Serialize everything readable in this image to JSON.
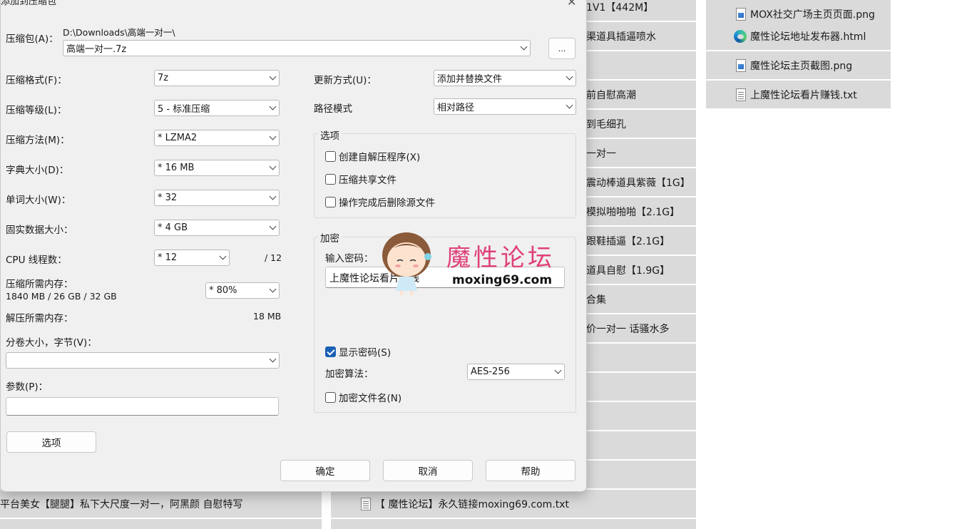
{
  "background": {
    "right_column": [
      {
        "icon": "image-file-icon",
        "name": "MOX社交广场主页页面.png"
      },
      {
        "icon": "edge-icon",
        "name": "魔性论坛地址发布器.html"
      },
      {
        "icon": "image-file-icon",
        "name": "魔性论坛主页截图.png"
      },
      {
        "icon": "text-file-icon",
        "name": "上魔性论坛看片赚钱.txt"
      }
    ],
    "middle_column": [
      "1V1【442M】",
      "渠道具插逼喷水",
      "",
      "前自慰高潮",
      "到毛细孔",
      "一对一",
      "震动棒道具紫薇【1G】",
      "模拟啪啪啪【2.1G】",
      "跟鞋插逼【2.1G】",
      "道具自慰【1.9G】",
      "合集",
      "价一对一 话骚水多",
      "",
      "",
      "",
      "",
      ""
    ],
    "bottom_left": "平台美女【腿腿】私下大尺度一对一，阿黑颜 自慰特写",
    "bottom_middle": "【 魔性论坛】永久链接moxing69.com.txt"
  },
  "dialog": {
    "title": "添加到压缩包",
    "archive_label": "压缩包(A)：",
    "archive_path": "D:\\Downloads\\高端一对一\\",
    "archive_name": "高端一对一.7z",
    "browse_label": "...",
    "left": {
      "format_label": "压缩格式(F)：",
      "format_value": "7z",
      "level_label": "压缩等级(L)：",
      "level_value": "5 - 标准压缩",
      "method_label": "压缩方法(M)：",
      "method_value": "*  LZMA2",
      "dict_label": "字典大小(D)：",
      "dict_value": "*  16 MB",
      "word_label": "单词大小(W)：",
      "word_value": "*  32",
      "solid_label": "固实数据大小：",
      "solid_value": "*  4 GB",
      "cpu_label": "CPU 线程数：",
      "cpu_value": "*  12",
      "cpu_max": "/ 12",
      "mem_comp_label": "压缩所需内存：",
      "mem_comp_detail": "1840 MB / 26 GB / 32 GB",
      "mem_comp_value": "*  80%",
      "mem_decomp_label": "解压所需内存：",
      "mem_decomp_value": "18 MB",
      "split_label": "分卷大小，字节(V)：",
      "split_value": "",
      "params_label": "参数(P)：",
      "params_value": "",
      "options_button": "选项"
    },
    "right": {
      "update_label": "更新方式(U)：",
      "update_value": "添加并替换文件",
      "path_label": "路径模式",
      "path_value": "相对路径",
      "options_group": "选项",
      "opt_sfx": "创建自解压程序(X)",
      "opt_sfx_checked": false,
      "opt_shared": "压缩共享文件",
      "opt_shared_checked": false,
      "opt_delete": "操作完成后删除源文件",
      "opt_delete_checked": false,
      "encrypt_group": "加密",
      "password_label": "输入密码：",
      "password_value": "上魔性论坛看片赚钱",
      "show_password": "显示密码(S)",
      "show_password_checked": true,
      "method_label": "加密算法：",
      "method_value": "AES-256",
      "encrypt_names": "加密文件名(N)",
      "encrypt_names_checked": false
    },
    "buttons": {
      "ok": "确定",
      "cancel": "取消",
      "help": "帮助"
    }
  },
  "watermark": {
    "text": "魔性论坛",
    "url": "moxing69.com"
  },
  "colors": {
    "accent": "#1a5fb4",
    "watermark": "#e0407a",
    "dialog_bg": "#f0f0f0",
    "tile_bg": "#dadada"
  }
}
